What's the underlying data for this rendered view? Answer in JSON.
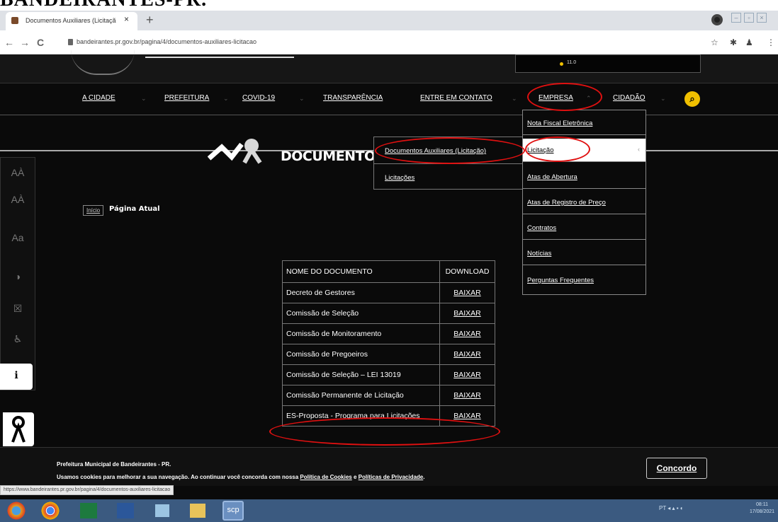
{
  "page_heading": "BANDEIRANTES-PR.",
  "browser": {
    "tab_title": "Documentos Auxiliares (Licitaçã",
    "tab_close": "×",
    "new_tab": "+",
    "back": "←",
    "forward": "→",
    "reload": "C",
    "url": "bandeirantes.pr.gov.br/pagina/4/documentos-auxiliares-licitacao",
    "status_url": "https://www.bandeirantes.pr.gov.br/pagina/4/documentos-auxiliares-licitacao"
  },
  "weather": {
    "temp": "11.0"
  },
  "nav": {
    "items": [
      {
        "label": "A CIDADE"
      },
      {
        "label": "PREFEITURA"
      },
      {
        "label": "COVID-19"
      },
      {
        "label": "TRANSPARÊNCIA"
      },
      {
        "label": "ENTRE EM CONTATO"
      },
      {
        "label": "EMPRESA"
      },
      {
        "label": "CIDADÃO"
      }
    ],
    "search_icon": "search-icon"
  },
  "empresa_menu": {
    "items": [
      {
        "label": "Nota Fiscal Eletrônica"
      },
      {
        "label": "Licitação"
      },
      {
        "label": "Atas de Abertura"
      },
      {
        "label": "Atas de Registro de Preço"
      },
      {
        "label": "Contratos"
      },
      {
        "label": "Notícias"
      },
      {
        "label": "Perguntas Frequentes"
      }
    ]
  },
  "licitacao_submenu": {
    "items": [
      {
        "label": "Documentos Auxiliares (Licitação)"
      },
      {
        "label": "Licitações"
      }
    ]
  },
  "hero": {
    "title": "DOCUMENTOS AU"
  },
  "accessibility": {
    "buttons": [
      "AÀ",
      "AÀ",
      "Aa",
      "◑",
      "☒",
      "♿",
      "ℹ"
    ]
  },
  "breadcrumb": {
    "home": "Início",
    "current": "Página Atual"
  },
  "documents": {
    "headers": [
      "NOME DO DOCUMENTO",
      "DOWNLOAD"
    ],
    "rows": [
      {
        "name": "Decreto de Gestores",
        "download": "BAIXAR"
      },
      {
        "name": "Comissão de Seleção",
        "download": "BAIXAR"
      },
      {
        "name": "Comissão de Monitoramento",
        "download": "BAIXAR"
      },
      {
        "name": "Comissão de Pregoeiros",
        "download": "BAIXAR"
      },
      {
        "name": "Comissão de Seleção – LEI 13019",
        "download": "BAIXAR"
      },
      {
        "name": "Comissão Permanente de Licitação",
        "download": "BAIXAR"
      },
      {
        "name": "ES-Proposta - Programa para Licitações",
        "download": "BAIXAR"
      }
    ]
  },
  "cookie": {
    "title": "Prefeitura Municipal de Bandeirantes - PR.",
    "text_prefix": "Usamos cookies para melhorar a sua navegação. Ao continuar você concorda com nossa ",
    "link1": "Política de Cookies",
    "text_mid": " e ",
    "link2": "Políticas de Privacidade",
    "text_end": ".",
    "accept_label": "Concordo"
  },
  "taskbar": {
    "scp_label": "scp",
    "tray_text": "PT  ◂  ▴ ▪ ◐",
    "clock_time": "08:11",
    "clock_date": "17/08/2021"
  },
  "colors": {
    "site_bg": "#0a0a0a",
    "accent_yellow": "#f0c000",
    "annotation_red": "#e01010",
    "taskbar": "#3b5a80"
  }
}
